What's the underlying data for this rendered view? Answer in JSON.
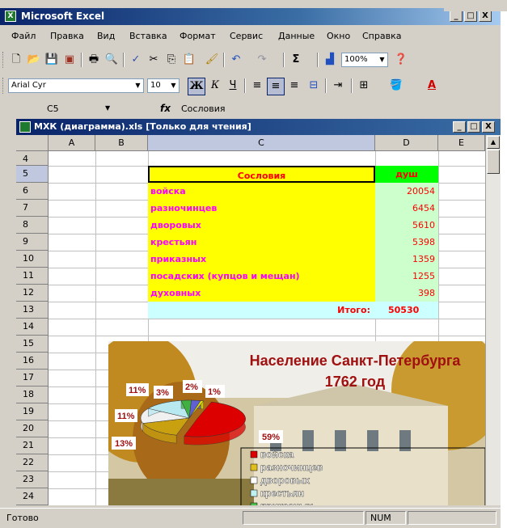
{
  "app": {
    "title": "Microsoft Excel",
    "window_buttons": [
      "_",
      "□",
      "X"
    ]
  },
  "menu": [
    "Файл",
    "Правка",
    "Вид",
    "Вставка",
    "Формат",
    "Сервис",
    "Данные",
    "Окно",
    "Справка"
  ],
  "toolbar": {
    "zoom": "100%",
    "font_name": "Arial Cyr",
    "font_size": "10"
  },
  "formula_bar": {
    "cell_ref": "C5",
    "fx": "fx",
    "content": "Сословия"
  },
  "workbook": {
    "title": "МХК (диаграмма).xls  [Только для чтения]",
    "columns": [
      "A",
      "B",
      "C",
      "D",
      "E"
    ],
    "selected_column": "C",
    "rows": [
      "4",
      "5",
      "6",
      "7",
      "8",
      "9",
      "10",
      "11",
      "12",
      "13",
      "14",
      "15",
      "16",
      "17",
      "18",
      "19",
      "20",
      "21",
      "22",
      "23",
      "24"
    ],
    "selected_row": "5",
    "header_c": "Сословия",
    "header_d": "душ",
    "data": [
      {
        "label": "войска",
        "value": "20054"
      },
      {
        "label": "разночинцев",
        "value": "6454"
      },
      {
        "label": "дворовых",
        "value": "5610"
      },
      {
        "label": "крестьян",
        "value": "5398"
      },
      {
        "label": "приказных",
        "value": "1359"
      },
      {
        "label": "посадских (купцов и мещан)",
        "value": "1255"
      },
      {
        "label": "духовных",
        "value": "398"
      }
    ],
    "total_label": "Итого:",
    "total_value": "50530"
  },
  "chart": {
    "title_line1": "Население Санкт-Петербурга",
    "title_line2": "1762 год",
    "slice_labels": [
      "59%",
      "13%",
      "11%",
      "11%",
      "3%",
      "2%",
      "1%"
    ],
    "legend": [
      {
        "label": "войска",
        "color": "#dd0000"
      },
      {
        "label": "разночинцев",
        "color": "#e0c020"
      },
      {
        "label": "дворовых",
        "color": "#ffffff"
      },
      {
        "label": "крестьян",
        "color": "#c0f0f0"
      },
      {
        "label": "приказных",
        "color": "#50c050"
      }
    ]
  },
  "status": {
    "ready": "Готово",
    "num": "NUM"
  }
}
